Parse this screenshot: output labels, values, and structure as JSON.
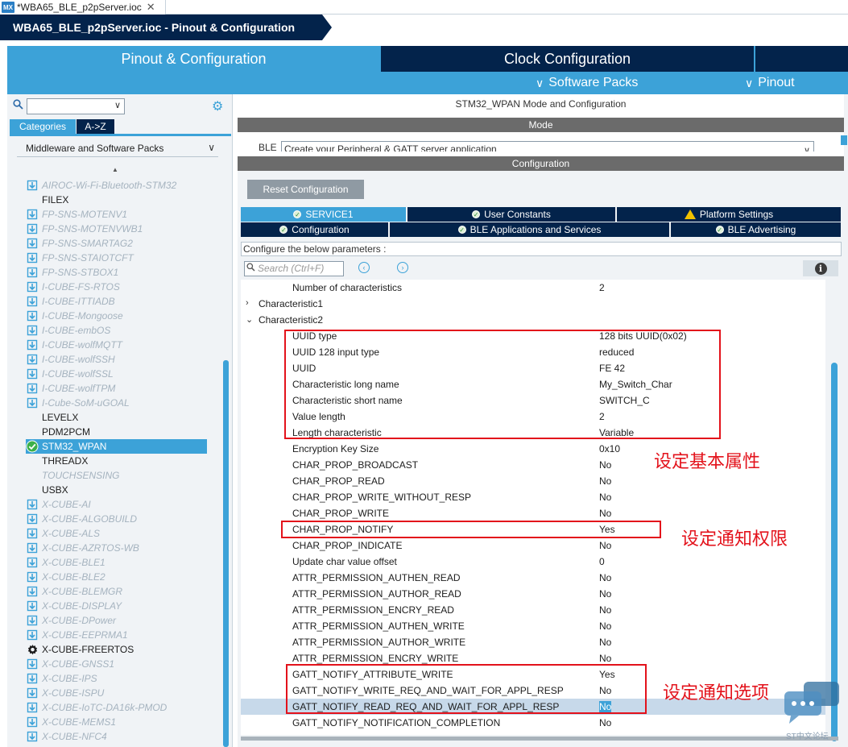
{
  "window": {
    "file_tab": "*WBA65_BLE_p2pServer.ioc",
    "app_badge": "MX",
    "breadcrumb": "WBA65_BLE_p2pServer.ioc - Pinout & Configuration"
  },
  "main_tabs": {
    "pinout": "Pinout & Configuration",
    "clock": "Clock Configuration",
    "software_packs": "Software Packs",
    "pinout_menu": "Pinout"
  },
  "left": {
    "category_tabs": [
      "Categories",
      "A->Z"
    ],
    "category": "Middleware and Software Packs",
    "items": [
      {
        "label": "AIROC-Wi-Fi-Bluetooth-STM32",
        "state": "disabled",
        "icon": "download-icon"
      },
      {
        "label": "FILEX",
        "state": "normal",
        "icon": ""
      },
      {
        "label": "FP-SNS-MOTENV1",
        "state": "disabled",
        "icon": "download-icon"
      },
      {
        "label": "FP-SNS-MOTENVWB1",
        "state": "disabled",
        "icon": "download-icon"
      },
      {
        "label": "FP-SNS-SMARTAG2",
        "state": "disabled",
        "icon": "download-icon"
      },
      {
        "label": "FP-SNS-STAIOTCFT",
        "state": "disabled",
        "icon": "download-icon"
      },
      {
        "label": "FP-SNS-STBOX1",
        "state": "disabled",
        "icon": "download-icon"
      },
      {
        "label": "I-CUBE-FS-RTOS",
        "state": "disabled",
        "icon": "download-icon"
      },
      {
        "label": "I-CUBE-ITTIADB",
        "state": "disabled",
        "icon": "download-icon"
      },
      {
        "label": "I-CUBE-Mongoose",
        "state": "disabled",
        "icon": "download-icon"
      },
      {
        "label": "I-CUBE-embOS",
        "state": "disabled",
        "icon": "download-icon"
      },
      {
        "label": "I-CUBE-wolfMQTT",
        "state": "disabled",
        "icon": "download-icon"
      },
      {
        "label": "I-CUBE-wolfSSH",
        "state": "disabled",
        "icon": "download-icon"
      },
      {
        "label": "I-CUBE-wolfSSL",
        "state": "disabled",
        "icon": "download-icon"
      },
      {
        "label": "I-CUBE-wolfTPM",
        "state": "disabled",
        "icon": "download-icon"
      },
      {
        "label": "I-Cube-SoM-uGOAL",
        "state": "disabled",
        "icon": "download-icon"
      },
      {
        "label": "LEVELX",
        "state": "normal",
        "icon": ""
      },
      {
        "label": "PDM2PCM",
        "state": "normal",
        "icon": ""
      },
      {
        "label": "STM32_WPAN",
        "state": "selected",
        "icon": "check-circle-icon"
      },
      {
        "label": "THREADX",
        "state": "normal",
        "icon": ""
      },
      {
        "label": "TOUCHSENSING",
        "state": "disabled",
        "icon": ""
      },
      {
        "label": "USBX",
        "state": "normal",
        "icon": ""
      },
      {
        "label": "X-CUBE-AI",
        "state": "disabled",
        "icon": "download-icon"
      },
      {
        "label": "X-CUBE-ALGOBUILD",
        "state": "disabled",
        "icon": "download-icon"
      },
      {
        "label": "X-CUBE-ALS",
        "state": "disabled",
        "icon": "download-icon"
      },
      {
        "label": "X-CUBE-AZRTOS-WB",
        "state": "disabled",
        "icon": "download-icon"
      },
      {
        "label": "X-CUBE-BLE1",
        "state": "disabled",
        "icon": "download-icon"
      },
      {
        "label": "X-CUBE-BLE2",
        "state": "disabled",
        "icon": "download-icon"
      },
      {
        "label": "X-CUBE-BLEMGR",
        "state": "disabled",
        "icon": "download-icon"
      },
      {
        "label": "X-CUBE-DISPLAY",
        "state": "disabled",
        "icon": "download-icon"
      },
      {
        "label": "X-CUBE-DPower",
        "state": "disabled",
        "icon": "download-icon"
      },
      {
        "label": "X-CUBE-EEPRMA1",
        "state": "disabled",
        "icon": "download-icon"
      },
      {
        "label": "X-CUBE-FREERTOS",
        "state": "normal",
        "icon": "gear-icon"
      },
      {
        "label": "X-CUBE-GNSS1",
        "state": "disabled",
        "icon": "download-icon"
      },
      {
        "label": "X-CUBE-IPS",
        "state": "disabled",
        "icon": "download-icon"
      },
      {
        "label": "X-CUBE-ISPU",
        "state": "disabled",
        "icon": "download-icon"
      },
      {
        "label": "X-CUBE-IoTC-DA16k-PMOD",
        "state": "disabled",
        "icon": "download-icon"
      },
      {
        "label": "X-CUBE-MEMS1",
        "state": "disabled",
        "icon": "download-icon"
      },
      {
        "label": "X-CUBE-NFC4",
        "state": "disabled",
        "icon": "download-icon"
      }
    ]
  },
  "right": {
    "title": "STM32_WPAN Mode and Configuration",
    "mode_header": "Mode",
    "mode_label": "BLE",
    "mode_value": "Create your Peripheral & GATT server application",
    "config_header": "Configuration",
    "reset_button": "Reset Configuration",
    "tabs_row1": [
      "SERVICE1",
      "User Constants",
      "Platform Settings"
    ],
    "tabs_row2": [
      "Configuration",
      "BLE Applications and Services",
      "BLE Advertising"
    ],
    "param_header": "Configure the below parameters :",
    "search_placeholder": "Search (Ctrl+F)",
    "params": [
      {
        "name": "Number of characteristics",
        "value": "2",
        "level": 2
      },
      {
        "name": "Characteristic1",
        "value": "",
        "level": 1,
        "expander": ">"
      },
      {
        "name": "Characteristic2",
        "value": "",
        "level": 1,
        "expander": "v"
      },
      {
        "name": "UUID type",
        "value": "128 bits UUID(0x02)",
        "level": 2
      },
      {
        "name": "UUID 128 input type",
        "value": "reduced",
        "level": 2
      },
      {
        "name": "UUID",
        "value": "FE 42",
        "level": 2
      },
      {
        "name": "Characteristic long name",
        "value": "My_Switch_Char",
        "level": 2
      },
      {
        "name": "Characteristic short name",
        "value": "SWITCH_C",
        "level": 2
      },
      {
        "name": "Value length",
        "value": "2",
        "level": 2
      },
      {
        "name": "Length characteristic",
        "value": "Variable",
        "level": 2
      },
      {
        "name": "Encryption Key Size",
        "value": "0x10",
        "level": 2
      },
      {
        "name": "CHAR_PROP_BROADCAST",
        "value": "No",
        "level": 2
      },
      {
        "name": "CHAR_PROP_READ",
        "value": "No",
        "level": 2
      },
      {
        "name": "CHAR_PROP_WRITE_WITHOUT_RESP",
        "value": "No",
        "level": 2
      },
      {
        "name": "CHAR_PROP_WRITE",
        "value": "No",
        "level": 2
      },
      {
        "name": "CHAR_PROP_NOTIFY",
        "value": "Yes",
        "level": 2
      },
      {
        "name": "CHAR_PROP_INDICATE",
        "value": "No",
        "level": 2
      },
      {
        "name": "Update char value offset",
        "value": "0",
        "level": 2
      },
      {
        "name": "ATTR_PERMISSION_AUTHEN_READ",
        "value": "No",
        "level": 2
      },
      {
        "name": "ATTR_PERMISSION_AUTHOR_READ",
        "value": "No",
        "level": 2
      },
      {
        "name": "ATTR_PERMISSION_ENCRY_READ",
        "value": "No",
        "level": 2
      },
      {
        "name": "ATTR_PERMISSION_AUTHEN_WRITE",
        "value": "No",
        "level": 2
      },
      {
        "name": "ATTR_PERMISSION_AUTHOR_WRITE",
        "value": "No",
        "level": 2
      },
      {
        "name": "ATTR_PERMISSION_ENCRY_WRITE",
        "value": "No",
        "level": 2
      },
      {
        "name": "GATT_NOTIFY_ATTRIBUTE_WRITE",
        "value": "Yes",
        "level": 2
      },
      {
        "name": "GATT_NOTIFY_WRITE_REQ_AND_WAIT_FOR_APPL_RESP",
        "value": "No",
        "level": 2
      },
      {
        "name": "GATT_NOTIFY_READ_REQ_AND_WAIT_FOR_APPL_RESP",
        "value": "No",
        "level": 2,
        "highlight": true
      },
      {
        "name": "GATT_NOTIFY_NOTIFICATION_COMPLETION",
        "value": "No",
        "level": 2
      }
    ]
  },
  "annotations": {
    "basic": "设定基本属性",
    "notify_perm": "设定通知权限",
    "notify_opt": "设定通知选项"
  },
  "watermark": "ST中文论坛",
  "colors": {
    "navy": "#03234b",
    "blue": "#3ca2d8",
    "annotation_red": "#e3121b"
  }
}
